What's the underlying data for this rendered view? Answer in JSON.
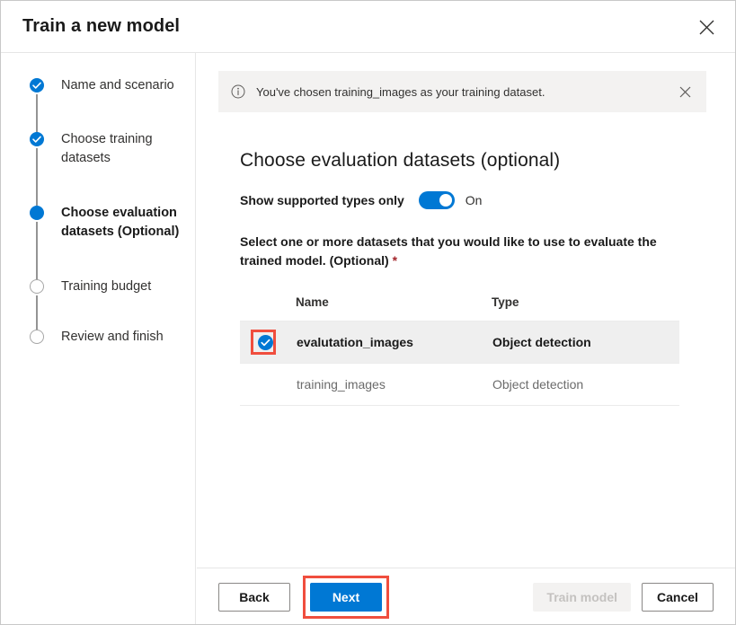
{
  "dialog": {
    "title": "Train a new model",
    "close_icon": "close-icon"
  },
  "sidebar": {
    "steps": [
      {
        "label": "Name and scenario",
        "state": "done"
      },
      {
        "label": "Choose training datasets",
        "state": "done"
      },
      {
        "label": "Choose evaluation datasets (Optional)",
        "state": "active"
      },
      {
        "label": "Training budget",
        "state": "todo"
      },
      {
        "label": "Review and finish",
        "state": "todo"
      }
    ]
  },
  "banner": {
    "icon": "info-circle-icon",
    "text": "You've chosen training_images as your training dataset.",
    "close_icon": "close-icon"
  },
  "main": {
    "heading": "Choose evaluation datasets (optional)",
    "toggle": {
      "label": "Show supported types only",
      "state_label": "On",
      "checked": true
    },
    "instruction": "Select one or more datasets that you would like to use to evaluate the trained model. (Optional)",
    "required_marker": "*"
  },
  "table": {
    "columns": [
      "",
      "Name",
      "Type"
    ],
    "rows": [
      {
        "selected": true,
        "name": "evalutation_images",
        "type": "Object detection"
      },
      {
        "selected": false,
        "name": "training_images",
        "type": "Object detection"
      }
    ]
  },
  "footer": {
    "back_label": "Back",
    "next_label": "Next",
    "train_label": "Train model",
    "cancel_label": "Cancel"
  },
  "colors": {
    "accent": "#0078d4",
    "annotation": "#f04e3e",
    "banner_bg": "#f3f2f1",
    "selected_row_bg": "#efefef",
    "required_star": "#a4262c"
  }
}
